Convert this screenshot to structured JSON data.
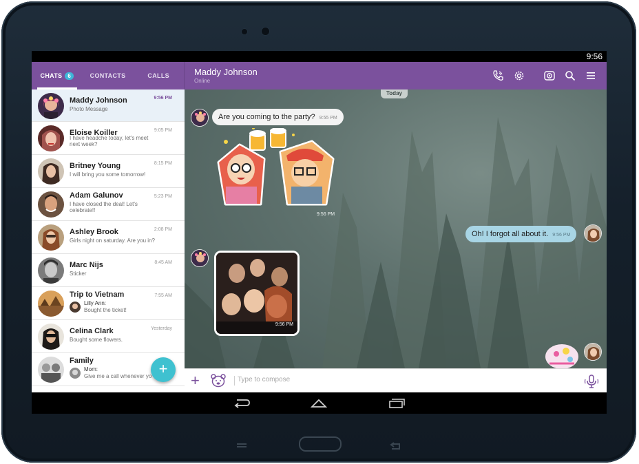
{
  "status_bar": {
    "time": "9:56"
  },
  "tabs": [
    {
      "label": "CHATS",
      "badge": "6",
      "active": true
    },
    {
      "label": "CONTACTS",
      "active": false
    },
    {
      "label": "CALLS",
      "active": false
    }
  ],
  "chats": [
    {
      "name": "Maddy Johnson",
      "preview": "Photo Message",
      "time": "9:56 PM",
      "selected": true,
      "avatar_color": "#8b3a62"
    },
    {
      "name": "Eloise Koiller",
      "preview": "I have headche today, let's meet next week?",
      "time": "9:05 PM",
      "avatar_color": "#a0524d"
    },
    {
      "name": "Britney Young",
      "preview": "I will bring you some tomorrow!",
      "time": "8:15 PM",
      "avatar_color": "#6b4e3d"
    },
    {
      "name": "Adam Galunov",
      "preview": "I have closed the deal! Let's celebrate!!",
      "time": "5:23 PM",
      "avatar_color": "#7a5b45"
    },
    {
      "name": "Ashley Brook",
      "preview": "Girls night on saturday. Are you in?",
      "time": "2:08 PM",
      "avatar_color": "#b57a54"
    },
    {
      "name": "Marc Nijs",
      "preview": "Sticker",
      "time": "8:45 AM",
      "avatar_color": "#5c5c5c"
    },
    {
      "name": "Trip to Vietnam",
      "sub_sender": "Lilly Ann:",
      "preview": "Bought the ticket!",
      "time": "7:55 AM",
      "avatar_color": "#c08a4a"
    },
    {
      "name": "Celina Clark",
      "preview": "Bought some flowers.",
      "time": "Yesterday",
      "avatar_color": "#3b3b3b"
    },
    {
      "name": "Family",
      "sub_sender": "Mom:",
      "preview": "Give me a call whenever yo",
      "time": "Ye",
      "avatar_color": "#8d8d8d"
    }
  ],
  "conversation": {
    "contact_name": "Maddy Johnson",
    "contact_status": "Online",
    "date_divider": "Today",
    "messages": [
      {
        "type": "text",
        "direction": "in",
        "text": "Are you coming to the party?",
        "time": "9:55 PM"
      },
      {
        "type": "sticker",
        "direction": "in",
        "time": "9:56 PM"
      },
      {
        "type": "text",
        "direction": "out",
        "text": "Oh! I forgot all about it.",
        "time": "9:56 PM"
      },
      {
        "type": "photo",
        "direction": "in",
        "time": "9:56 PM"
      },
      {
        "type": "sticker",
        "direction": "out"
      }
    ],
    "composer_placeholder": "Type to compose"
  },
  "header_icons": [
    "phone-icon",
    "settings-icon",
    "video-icon",
    "search-icon",
    "menu-icon"
  ],
  "colors": {
    "brand_purple": "#7b519d",
    "fab_teal": "#3fc1d0",
    "outgoing_bubble": "#a8d5e5",
    "incoming_bubble": "#f3f3f3",
    "badge_blue": "#3fb6d8"
  }
}
